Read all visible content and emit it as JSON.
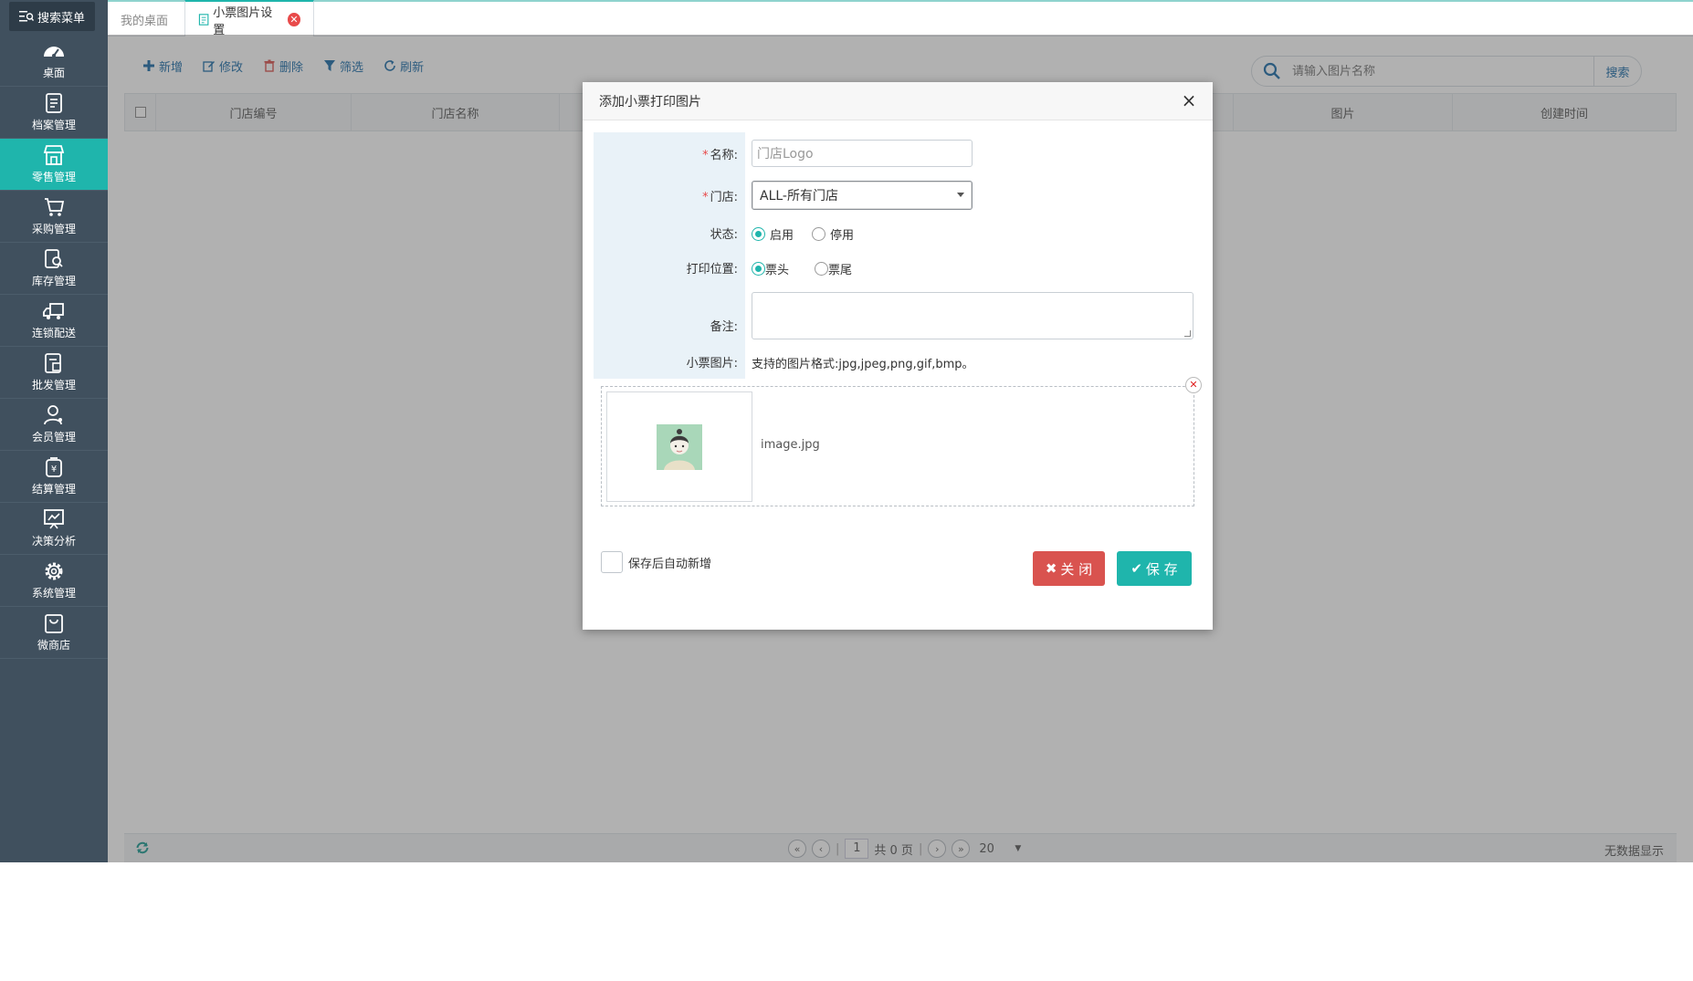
{
  "sidebar": {
    "search_label": "搜索菜单",
    "items": [
      {
        "label": "桌面",
        "icon": "dashboard-icon"
      },
      {
        "label": "档案管理",
        "icon": "archive-icon"
      },
      {
        "label": "零售管理",
        "icon": "store-icon",
        "active": true
      },
      {
        "label": "采购管理",
        "icon": "cart-icon"
      },
      {
        "label": "库存管理",
        "icon": "inventory-icon"
      },
      {
        "label": "连锁配送",
        "icon": "truck-icon"
      },
      {
        "label": "批发管理",
        "icon": "wholesale-icon"
      },
      {
        "label": "会员管理",
        "icon": "member-icon"
      },
      {
        "label": "结算管理",
        "icon": "settlement-icon"
      },
      {
        "label": "决策分析",
        "icon": "chart-icon"
      },
      {
        "label": "系统管理",
        "icon": "gear-icon"
      },
      {
        "label": "微商店",
        "icon": "shop-bag-icon"
      }
    ]
  },
  "tabs": {
    "home": "我的桌面",
    "current": "小票图片设置"
  },
  "toolbar": {
    "add": "新增",
    "edit": "修改",
    "delete": "删除",
    "filter": "筛选",
    "refresh": "刷新",
    "search_placeholder": "请输入图片名称",
    "search_btn": "搜索"
  },
  "grid": {
    "columns": [
      "门店编号",
      "门店名称",
      "",
      "",
      "图片",
      "创建时间"
    ]
  },
  "pager": {
    "page": "1",
    "total": "共 0 页",
    "page_size": "20",
    "status": "无数据显示"
  },
  "dialog": {
    "title": "添加小票打印图片",
    "name_label": "名称:",
    "name_placeholder": "门店Logo",
    "store_label": "门店:",
    "store_value": "ALL-所有门店",
    "status_label": "状态:",
    "status_on": "启用",
    "status_off": "停用",
    "print_pos_label": "打印位置:",
    "pos_head": "票头",
    "pos_tail": "票尾",
    "remark_label": "备注:",
    "image_label": "小票图片:",
    "image_hint": "支持的图片格式:jpg,jpeg,png,gif,bmp。",
    "file_name": "image.jpg",
    "auto_new": "保存后自动新增",
    "close_btn": "关 闭",
    "save_btn": "保 存"
  }
}
